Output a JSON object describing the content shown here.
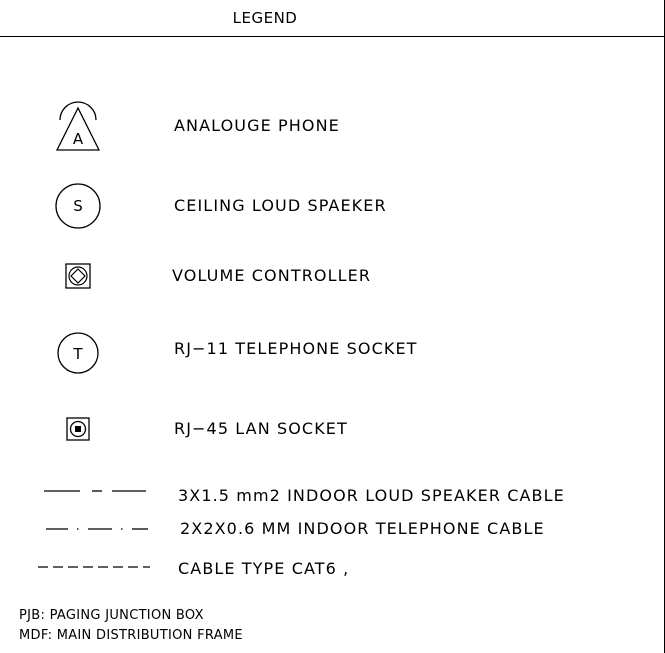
{
  "title": "LEGEND",
  "items": [
    {
      "symbol": "analogue-phone",
      "symbol_letter": "A",
      "label": "ANALOUGE   PHONE"
    },
    {
      "symbol": "ceiling-speaker",
      "symbol_letter": "S",
      "label": "CEILING  LOUD  SPAEKER"
    },
    {
      "symbol": "volume-controller",
      "label": "VOLUME  CONTROLLER"
    },
    {
      "symbol": "rj11-socket",
      "symbol_letter": "T",
      "label": "RJ−11  TELEPHONE  SOCKET"
    },
    {
      "symbol": "rj45-socket",
      "label": "RJ−45  LAN  SOCKET"
    }
  ],
  "cables": [
    {
      "pattern": "long-short-long",
      "label": "3X1.5  mm2  INDOOR  LOUD  SPEAKER  CABLE"
    },
    {
      "pattern": "dash-dot",
      "label": "2X2X0.6  MM  INDOOR  TELEPHONE  CABLE"
    },
    {
      "pattern": "dashed",
      "label": "CABLE  TYPE  CAT6  ,"
    }
  ],
  "notes": [
    "PJB:  PAGING  JUNCTION  BOX",
    "MDF:  MAIN  DISTRIBUTION  FRAME"
  ]
}
